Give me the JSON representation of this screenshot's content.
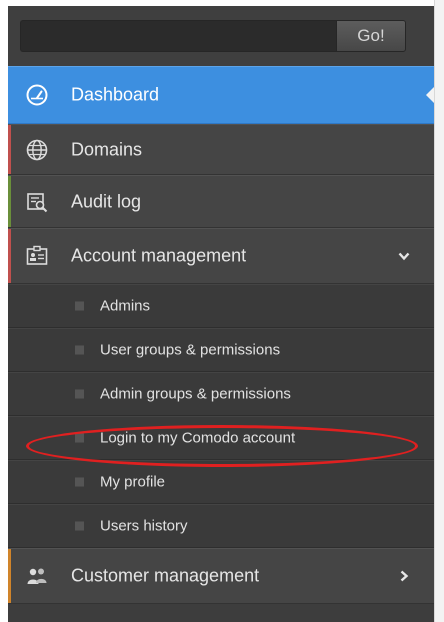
{
  "search": {
    "value": "",
    "placeholder": "",
    "button_label": "Go!"
  },
  "nav": {
    "dashboard": "Dashboard",
    "domains": "Domains",
    "audit_log": "Audit log",
    "account_management": "Account management",
    "customer_management": "Customer management"
  },
  "submenu": [
    "Admins",
    "User groups & permissions",
    "Admin groups & permissions",
    "Login to my Comodo account",
    "My profile",
    "Users history"
  ],
  "colors": {
    "active": "#3d8fe0",
    "domains_accent": "#c0504d",
    "audit_accent": "#6a8f3a",
    "account_accent": "#c0504d",
    "customer_accent": "#d0842a",
    "highlight": "#e02020"
  },
  "icons": {
    "dashboard": "speedometer-icon",
    "domains": "globe-icon",
    "audit_log": "document-search-icon",
    "account_management": "id-card-icon",
    "customer_management": "users-icon"
  }
}
